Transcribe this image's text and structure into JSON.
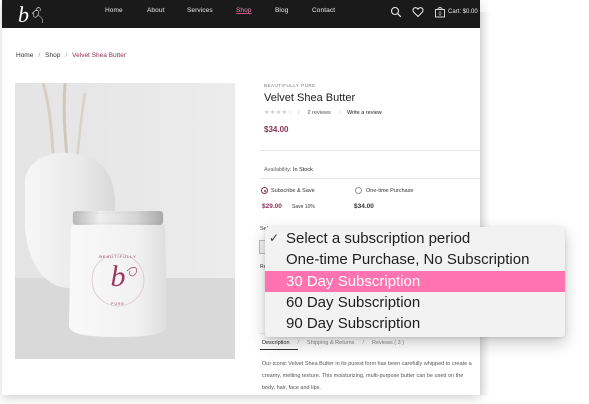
{
  "nav": {
    "logo_letter": "b",
    "links": [
      "Home",
      "About",
      "Services",
      "Shop",
      "Blog",
      "Contact"
    ],
    "active": "Shop",
    "cart_count": "0",
    "cart_label": "Cart: $0.00"
  },
  "breadcrumb": [
    "Home",
    "Shop",
    "Velvet Shea Butter"
  ],
  "product": {
    "brand": "BEAUTIFULLY PURE",
    "title": "Velvet Shea Butter",
    "stars_text": "★★★★☆",
    "reviews": "2 reviews",
    "write_review": "Write a review",
    "price": "$34.00",
    "availability_label": "Availability:",
    "availability_value": "In Stock",
    "option_subscribe": "Subscribe & Save",
    "option_onetime": "One-time Purchase",
    "subscribe_price": "$29.00",
    "save_text": "Save 10%",
    "onetime_price": "$34.00",
    "select_fragment": "Sel",
    "re_fragment": "Re",
    "jar_label_brand": "BEAUTIFULLY",
    "jar_label_sub": "PURE",
    "jar_letter": "b"
  },
  "tabs": {
    "description": "Description",
    "shipping": "Shipping & Returns",
    "reviews": "Reviews ( 3 )"
  },
  "description_text": "Our iconic Velvet Shea Butter in its purest form has been carefully whipped to create a creamy, melting texture. This moisturizing, multi-purpose butter can be used on the body, hair, face and lips.",
  "dropdown": {
    "options": [
      "Select a subscription period",
      "One-time Purchase, No Subscription",
      "30 Day Subscription",
      "60 Day Subscription",
      "90 Day Subscription"
    ],
    "checked_index": 0,
    "highlighted_index": 2,
    "checkmark": "✓"
  },
  "colors": {
    "accent": "#8e2f56",
    "highlight": "#ff73b0",
    "nav_bg": "#1a1a1a"
  }
}
